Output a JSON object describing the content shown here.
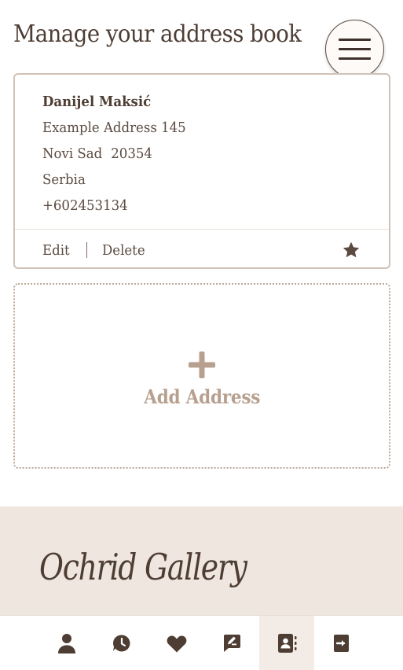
{
  "header": {
    "title": "Manage your address book",
    "menu_icon": "hamburger-menu-icon"
  },
  "address": {
    "name": "Danijel Maksić",
    "street": "Example Address 145",
    "city": "Novi Sad",
    "postal_code": "20354",
    "country": "Serbia",
    "phone": "+602453134",
    "edit_label": "Edit",
    "delete_label": "Delete",
    "default_icon": "star-icon"
  },
  "add_address": {
    "label": "Add Address",
    "icon": "plus-icon"
  },
  "footer": {
    "brand": "Ochrid Gallery"
  },
  "bottom_nav": {
    "items": [
      {
        "icon": "user-icon",
        "active": false
      },
      {
        "icon": "order-history-icon",
        "active": false
      },
      {
        "icon": "heart-icon",
        "active": false
      },
      {
        "icon": "reviews-icon",
        "active": false
      },
      {
        "icon": "address-book-icon",
        "active": true
      },
      {
        "icon": "logout-icon",
        "active": false
      }
    ]
  },
  "colors": {
    "text_dark": "#4d3d33",
    "accent_muted": "#b7a08f",
    "footer_bg": "#efe6df",
    "active_nav_bg": "#f3ece6"
  }
}
